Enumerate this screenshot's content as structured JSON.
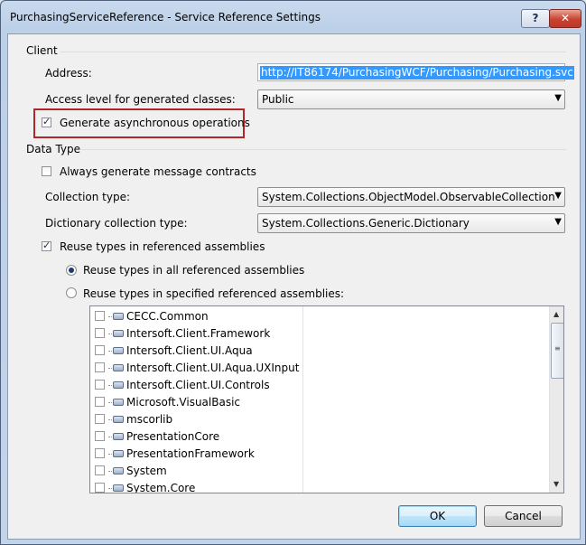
{
  "window": {
    "title": "PurchasingServiceReference - Service Reference Settings",
    "help_label": "?",
    "close_label": "✕"
  },
  "client": {
    "group_label": "Client",
    "address_label": "Address:",
    "address_value": "http://IT86174/PurchasingWCF/Purchasing/Purchasing.svc",
    "access_level_label": "Access level for generated classes:",
    "access_level_value": "Public",
    "generate_async_label": "Generate asynchronous operations",
    "generate_async_checked": true
  },
  "data_type": {
    "group_label": "Data Type",
    "always_generate_label": "Always generate message contracts",
    "always_generate_checked": false,
    "collection_type_label": "Collection type:",
    "collection_type_value": "System.Collections.ObjectModel.ObservableCollection",
    "dictionary_type_label": "Dictionary collection type:",
    "dictionary_type_value": "System.Collections.Generic.Dictionary",
    "reuse_types_label": "Reuse types in referenced assemblies",
    "reuse_types_checked": true,
    "reuse_all_label": "Reuse types in all referenced assemblies",
    "reuse_specified_label": "Reuse types in specified referenced assemblies:",
    "selected_option": "all",
    "assemblies": [
      "CECC.Common",
      "Intersoft.Client.Framework",
      "Intersoft.Client.UI.Aqua",
      "Intersoft.Client.UI.Aqua.UXInput",
      "Intersoft.Client.UI.Controls",
      "Microsoft.VisualBasic",
      "mscorlib",
      "PresentationCore",
      "PresentationFramework",
      "System",
      "System.Core"
    ]
  },
  "buttons": {
    "ok_label": "OK",
    "cancel_label": "Cancel"
  },
  "colors": {
    "selection": "#3399ff",
    "highlight_box": "#b0262a",
    "ok_accent": "#3c7fb1"
  },
  "icons": {
    "dropdown": "chevron-down-icon",
    "checkmark": "checkmark-icon",
    "assembly": "assembly-icon"
  }
}
